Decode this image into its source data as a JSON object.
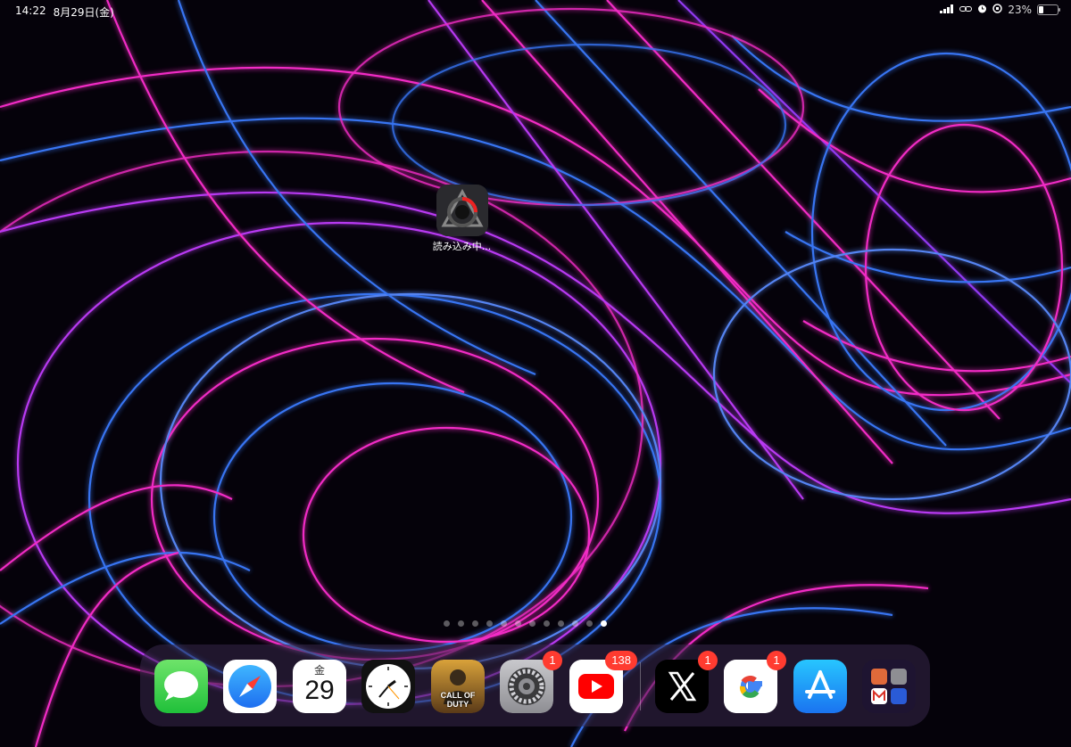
{
  "status_bar": {
    "time": "14:22",
    "date": "8月29日(金)",
    "battery_percent": "23%",
    "battery_level": 0.23
  },
  "home": {
    "loading_app": {
      "label": "読み込み中...",
      "icon": "game-download-icon"
    },
    "page_count": 12,
    "current_page": 12
  },
  "dock": {
    "apps": [
      {
        "name": "messages",
        "icon": "messages-icon",
        "badge": ""
      },
      {
        "name": "safari",
        "icon": "safari-compass-icon",
        "badge": ""
      },
      {
        "name": "calendar",
        "icon": "calendar-icon",
        "badge": "",
        "weekday": "金",
        "day": "29"
      },
      {
        "name": "clock",
        "icon": "clock-icon",
        "badge": ""
      },
      {
        "name": "call-of-duty",
        "icon": "call-of-duty-icon",
        "badge": "",
        "text": "CALL OF DUTY"
      },
      {
        "name": "settings",
        "icon": "settings-gear-icon",
        "badge": "1"
      },
      {
        "name": "youtube",
        "icon": "youtube-play-icon",
        "badge": "138"
      },
      {
        "name": "x",
        "icon": "x-logo-icon",
        "badge": "1"
      },
      {
        "name": "google",
        "icon": "google-g-icon",
        "badge": "1"
      },
      {
        "name": "app-store",
        "icon": "app-store-icon",
        "badge": ""
      },
      {
        "name": "app-library",
        "icon": "app-library-icon",
        "badge": ""
      }
    ]
  },
  "colors": {
    "neon_pink": "#ff2fd0",
    "neon_blue": "#3a7bff",
    "neon_violet": "#9a3cff",
    "badge_red": "#ff3b30"
  }
}
